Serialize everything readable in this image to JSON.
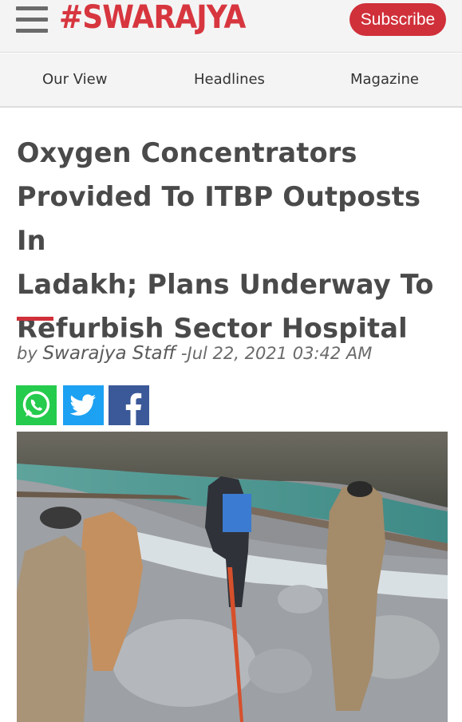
{
  "header": {
    "logo_text": "#SWARAJYA",
    "subscribe_label": "Subscribe",
    "menu_icon": "hamburger-menu-icon",
    "brand_color": "#d0303a"
  },
  "nav": {
    "items": [
      {
        "label": "Our View"
      },
      {
        "label": "Headlines"
      },
      {
        "label": "Magazine"
      }
    ]
  },
  "article": {
    "title_lines": [
      "Oxygen Concentrators",
      "Provided To ITBP Outposts In",
      "Ladakh; Plans Underway To",
      "Refurbish Sector Hospital"
    ],
    "byline_prefix": "by",
    "author": "Swarajya Staff",
    "date_separator": "-",
    "date": "Jul 22, 2021 03:42 AM",
    "share": [
      {
        "icon": "whatsapp-icon",
        "color": "#25cb4d"
      },
      {
        "icon": "twitter-icon",
        "color": "#1da1f2"
      },
      {
        "icon": "facebook-icon",
        "color": "#3b5998"
      }
    ],
    "hero_image": "photo-itbp-personnel-crossing-river"
  }
}
